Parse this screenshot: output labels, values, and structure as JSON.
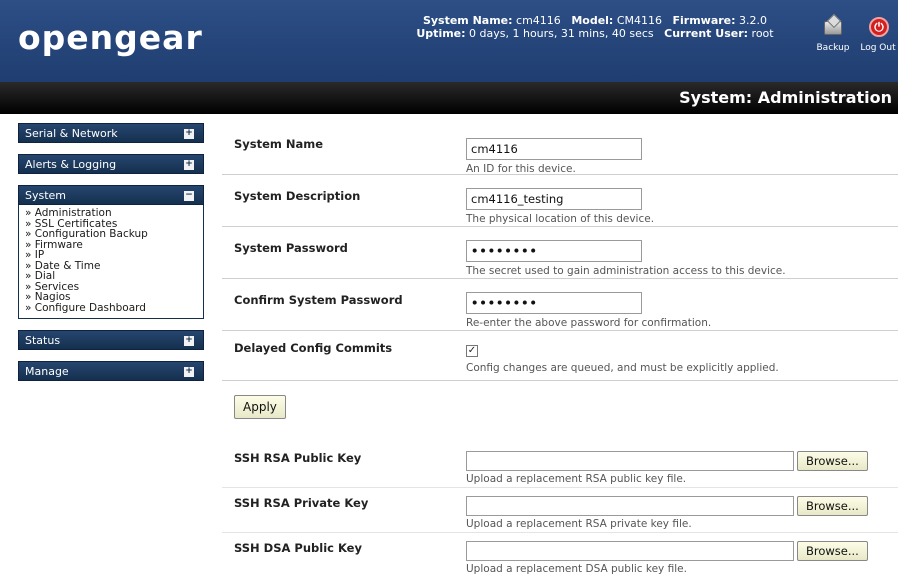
{
  "header": {
    "logo": "opengear",
    "system_name_label": "System Name:",
    "system_name": "cm4116",
    "model_label": "Model:",
    "model": "CM4116",
    "firmware_label": "Firmware:",
    "firmware": "3.2.0",
    "uptime_label": "Uptime:",
    "uptime": "0 days, 1 hours, 31 mins, 40 secs",
    "user_label": "Current User:",
    "user": "root",
    "backup_label": "Backup",
    "logout_label": "Log Out",
    "bg_color": "#1f3d70"
  },
  "page_title": "System: Administration",
  "sidebar": {
    "groups": [
      {
        "label": "Serial & Network",
        "toggle": "+"
      },
      {
        "label": "Alerts & Logging",
        "toggle": "+"
      },
      {
        "label": "System",
        "toggle": "−",
        "items": [
          "» Administration",
          "» SSL Certificates",
          "» Configuration Backup",
          "» Firmware",
          "» IP",
          "» Date & Time",
          "» Dial",
          "» Services",
          "» Nagios",
          "» Configure Dashboard"
        ]
      },
      {
        "label": "Status",
        "toggle": "+"
      },
      {
        "label": "Manage",
        "toggle": "+"
      }
    ]
  },
  "form": {
    "system_name": {
      "label": "System Name",
      "value": "cm4116",
      "hint": "An ID for this device."
    },
    "system_description": {
      "label": "System Description",
      "value": "cm4116_testing",
      "hint": "The physical location of this device."
    },
    "system_password": {
      "label": "System Password",
      "value": "••••••••",
      "hint": "The secret used to gain administration access to this device."
    },
    "confirm_password": {
      "label": "Confirm System Password",
      "value": "••••••••",
      "hint": "Re-enter the above password for confirmation."
    },
    "delayed_commits": {
      "label": "Delayed Config Commits",
      "checked": "✓",
      "hint": "Config changes are queued, and must be explicitly applied."
    },
    "apply_label": "Apply",
    "ssh_rsa_public": {
      "label": "SSH RSA Public Key",
      "browse": "Browse...",
      "hint": "Upload a replacement RSA public key file."
    },
    "ssh_rsa_private": {
      "label": "SSH RSA Private Key",
      "browse": "Browse...",
      "hint": "Upload a replacement RSA private key file."
    },
    "ssh_dsa_public": {
      "label": "SSH DSA Public Key",
      "browse": "Browse...",
      "hint": "Upload a replacement DSA public key file."
    }
  }
}
